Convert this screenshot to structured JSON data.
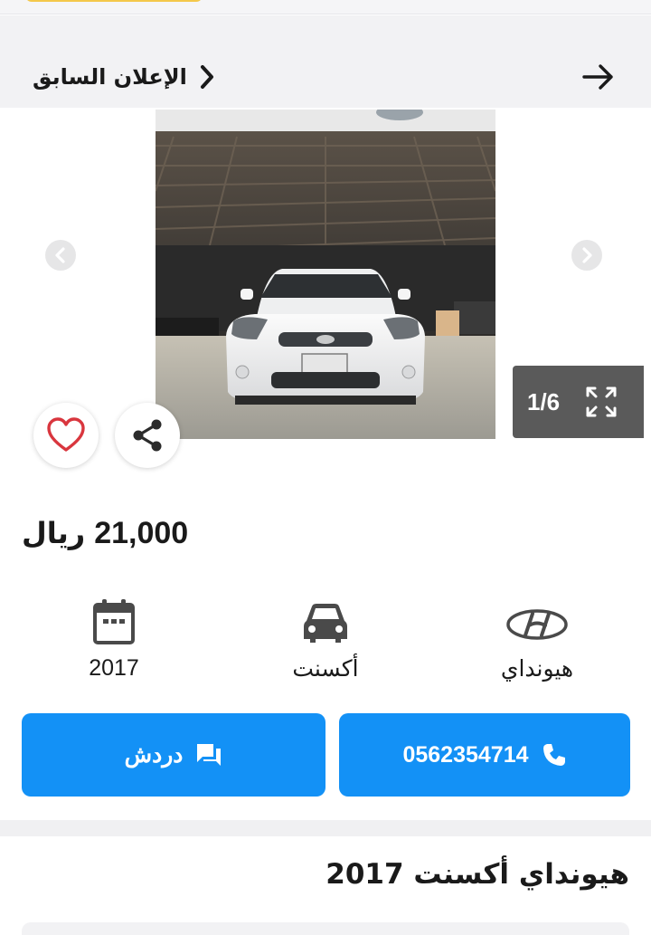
{
  "header": {
    "previous_ad_label": "الإعلان السابق",
    "icons": {
      "back": "arrow-right-icon",
      "previous": "chevron-right-icon"
    }
  },
  "gallery": {
    "counter": "1/6",
    "icons": {
      "expand": "expand-icon",
      "left": "chevron-left-icon",
      "right": "chevron-right-icon",
      "favorite": "heart-icon",
      "share": "share-icon"
    }
  },
  "listing": {
    "price_value": "21,000",
    "price_currency": "ريال",
    "title": "هيونداي أكسنت 2017"
  },
  "specs": {
    "year": "2017",
    "model": "أكسنت",
    "brand": "هيونداي"
  },
  "actions": {
    "chat_label": "دردش",
    "phone_number": "0562354714"
  },
  "colors": {
    "accent": "#1391f6",
    "favorite": "#d9363e",
    "counter_bg": "#5a5a5a",
    "nav_bg": "#f2f2f4"
  }
}
